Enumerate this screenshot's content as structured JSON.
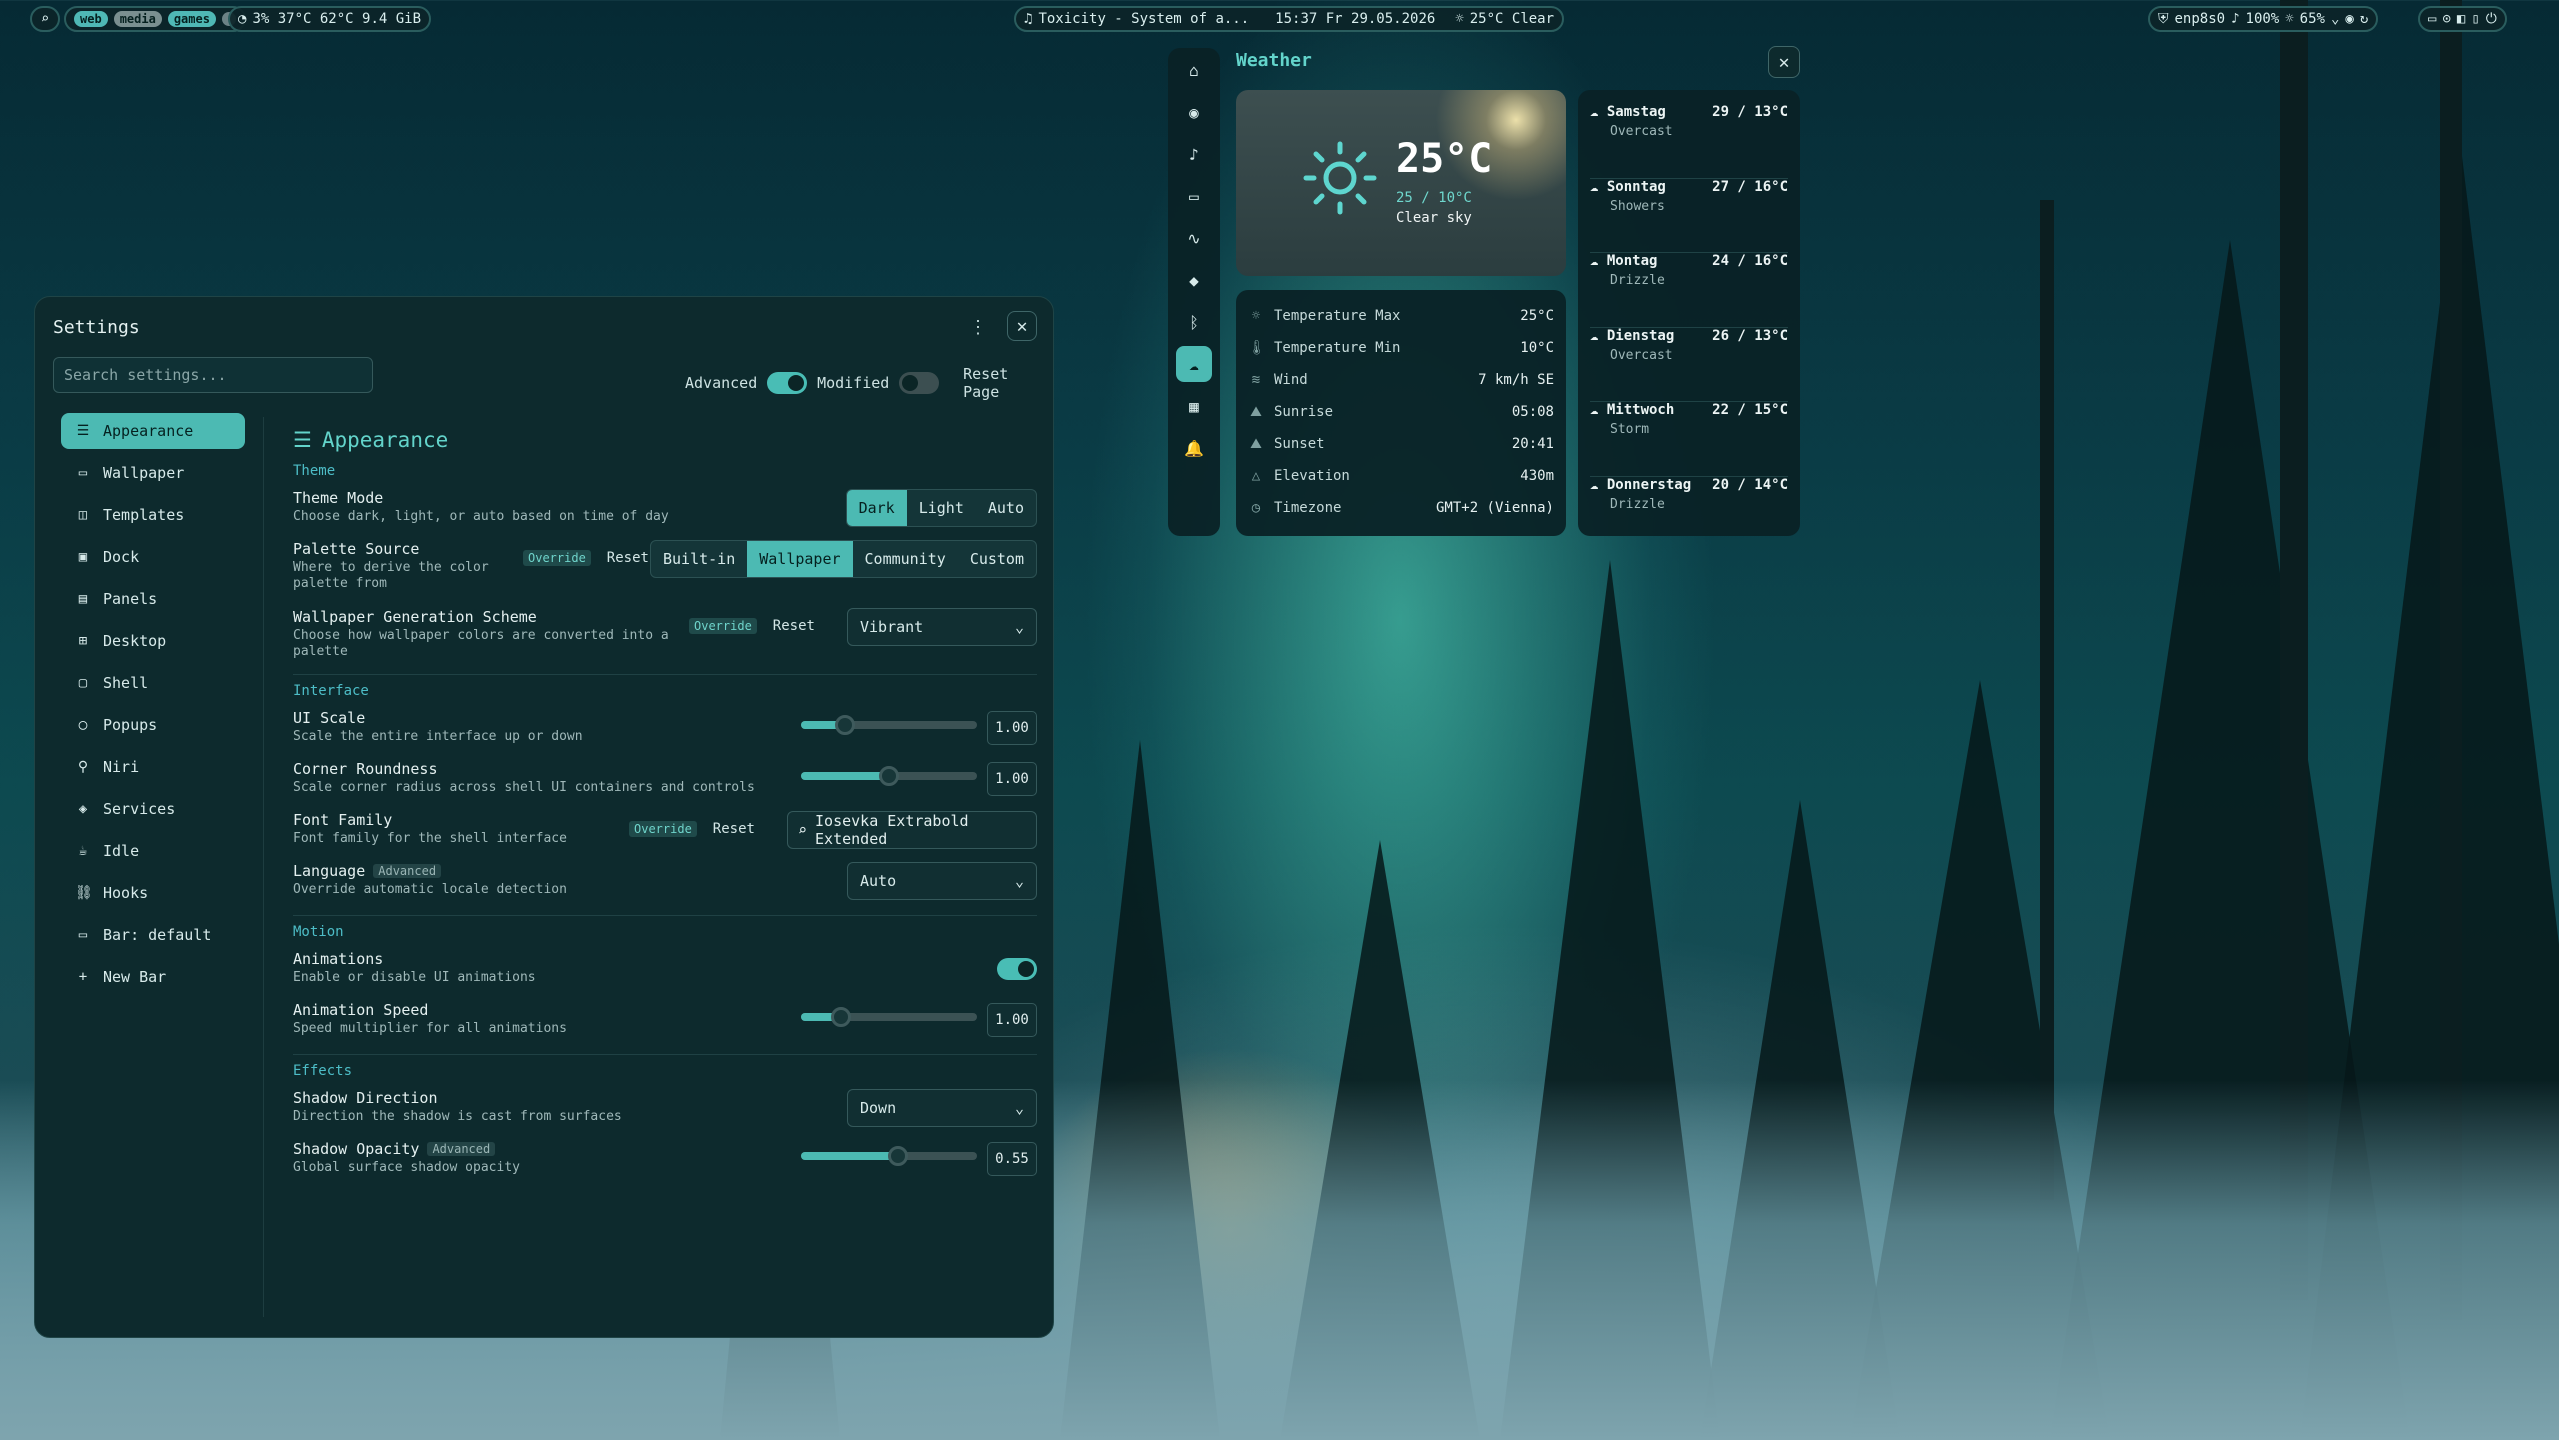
{
  "topbar": {
    "workspaces": [
      "web",
      "media",
      "games"
    ],
    "stats": "3%  37°C  62°C  9.4 GiB",
    "media_title": "Toxicity - System of a...",
    "datetime": "15:37 Fr 29.05.2026",
    "weather": "25°C Clear",
    "net": "enp8s0",
    "volume": "100%",
    "brightness": "65%"
  },
  "settings": {
    "title": "Settings",
    "search_placeholder": "Search settings...",
    "advanced_label": "Advanced",
    "advanced_on": true,
    "modified_label": "Modified",
    "modified_on": false,
    "reset_page": "Reset Page",
    "nav": [
      {
        "label": "Appearance",
        "icon": "sliders-icon",
        "glyph": "☰",
        "active": true
      },
      {
        "label": "Wallpaper",
        "icon": "paint-roller-icon",
        "glyph": "▭"
      },
      {
        "label": "Templates",
        "icon": "templates-icon",
        "glyph": "◫"
      },
      {
        "label": "Dock",
        "icon": "dock-icon",
        "glyph": "▣"
      },
      {
        "label": "Panels",
        "icon": "panels-icon",
        "glyph": "▤"
      },
      {
        "label": "Desktop",
        "icon": "desktop-icon",
        "glyph": "⊞"
      },
      {
        "label": "Shell",
        "icon": "shell-icon",
        "glyph": "▢"
      },
      {
        "label": "Popups",
        "icon": "popups-icon",
        "glyph": "◯"
      },
      {
        "label": "Niri",
        "icon": "niri-icon",
        "glyph": "⚲"
      },
      {
        "label": "Services",
        "icon": "services-icon",
        "glyph": "◈"
      },
      {
        "label": "Idle",
        "icon": "idle-icon",
        "glyph": "☕"
      },
      {
        "label": "Hooks",
        "icon": "hooks-icon",
        "glyph": "⛓"
      },
      {
        "label": "Bar: default",
        "icon": "bar-icon",
        "glyph": "▭"
      },
      {
        "label": "New Bar",
        "icon": "plus-icon",
        "glyph": "+"
      }
    ],
    "page": {
      "title": "Appearance",
      "sections": {
        "theme": "Theme",
        "interface": "Interface",
        "motion": "Motion",
        "effects": "Effects"
      },
      "theme_mode": {
        "label": "Theme Mode",
        "desc": "Choose dark, light, or auto based on time of day",
        "options": [
          "Dark",
          "Light",
          "Auto"
        ],
        "selected": "Dark"
      },
      "palette_source": {
        "label": "Palette Source",
        "desc": "Where to derive the color palette from",
        "override": "Override",
        "reset": "Reset",
        "options": [
          "Built-in",
          "Wallpaper",
          "Community",
          "Custom"
        ],
        "selected": "Wallpaper"
      },
      "wallpaper_scheme": {
        "label": "Wallpaper Generation Scheme",
        "desc": "Choose how wallpaper colors are converted into a palette",
        "override": "Override",
        "reset": "Reset",
        "value": "Vibrant"
      },
      "ui_scale": {
        "label": "UI Scale",
        "desc": "Scale the entire interface up or down",
        "value": "1.00",
        "fraction": 0.25
      },
      "corner_roundness": {
        "label": "Corner Roundness",
        "desc": "Scale corner radius across shell UI containers and controls",
        "value": "1.00",
        "fraction": 0.5
      },
      "font_family": {
        "label": "Font Family",
        "desc": "Font family for the shell interface",
        "override": "Override",
        "reset": "Reset",
        "value": "Iosevka Extrabold Extended"
      },
      "language": {
        "label": "Language",
        "tag": "Advanced",
        "desc": "Override automatic locale detection",
        "value": "Auto"
      },
      "animations": {
        "label": "Animations",
        "desc": "Enable or disable UI animations",
        "on": true
      },
      "animation_speed": {
        "label": "Animation Speed",
        "desc": "Speed multiplier for all animations",
        "value": "1.00",
        "fraction": 0.23
      },
      "shadow_direction": {
        "label": "Shadow Direction",
        "desc": "Direction the shadow is cast from surfaces",
        "value": "Down"
      },
      "shadow_opacity": {
        "label": "Shadow Opacity",
        "tag": "Advanced",
        "desc": "Global surface shadow opacity",
        "value": "0.55",
        "fraction": 0.55
      }
    }
  },
  "weather": {
    "title": "Weather",
    "temp": "25°C",
    "range": "25 / 10°C",
    "condition": "Clear sky",
    "details": [
      {
        "key": "Temperature Max",
        "value": "25°C",
        "icon": "thermometer-high-icon",
        "glyph": "☼"
      },
      {
        "key": "Temperature Min",
        "value": "10°C",
        "icon": "thermometer-icon",
        "glyph": "🌡"
      },
      {
        "key": "Wind",
        "value": "7 km/h SE",
        "icon": "wind-icon",
        "glyph": "≋"
      },
      {
        "key": "Sunrise",
        "value": "05:08",
        "icon": "sunrise-icon",
        "glyph": "⛰"
      },
      {
        "key": "Sunset",
        "value": "20:41",
        "icon": "sunset-icon",
        "glyph": "⛰"
      },
      {
        "key": "Elevation",
        "value": "430m",
        "icon": "mountain-icon",
        "glyph": "△"
      },
      {
        "key": "Timezone",
        "value": "GMT+2 (Vienna)",
        "icon": "clock-icon",
        "glyph": "◷"
      }
    ],
    "forecast": [
      {
        "day": "Samstag",
        "temps": "29 / 13°C",
        "cond": "Overcast"
      },
      {
        "day": "Sonntag",
        "temps": "27 / 16°C",
        "cond": "Showers"
      },
      {
        "day": "Montag",
        "temps": "24 / 16°C",
        "cond": "Drizzle"
      },
      {
        "day": "Dienstag",
        "temps": "26 / 13°C",
        "cond": "Overcast"
      },
      {
        "day": "Mittwoch",
        "temps": "22 / 15°C",
        "cond": "Storm"
      },
      {
        "day": "Donnerstag",
        "temps": "20 / 14°C",
        "cond": "Drizzle"
      }
    ],
    "rail": [
      {
        "icon": "home-icon",
        "glyph": "⌂"
      },
      {
        "icon": "media-icon",
        "glyph": "◉"
      },
      {
        "icon": "volume-icon",
        "glyph": "♪"
      },
      {
        "icon": "display-icon",
        "glyph": "▭"
      },
      {
        "icon": "activity-icon",
        "glyph": "∿"
      },
      {
        "icon": "wifi-icon",
        "glyph": "◆"
      },
      {
        "icon": "bluetooth-icon",
        "glyph": "ᛒ"
      },
      {
        "icon": "weather-icon",
        "glyph": "☁",
        "active": true
      },
      {
        "icon": "calendar-icon",
        "glyph": "▦"
      },
      {
        "icon": "bell-icon",
        "glyph": "🔔"
      }
    ]
  }
}
